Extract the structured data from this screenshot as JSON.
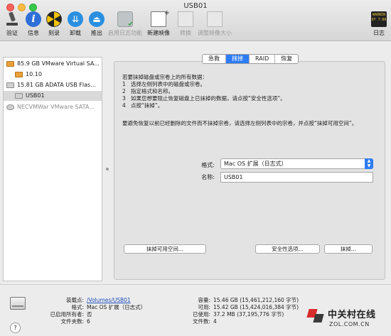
{
  "window": {
    "title": "USB01"
  },
  "toolbar": {
    "verify": "验证",
    "info": "信息",
    "burn": "刻录",
    "unmount": "卸载",
    "eject": "推出",
    "enable_journaling": "启用日志功能",
    "new_image": "新建映像",
    "convert": "转换",
    "resize_image": "调整映像大小",
    "log": "日志",
    "log_icon_text": "WARNIN\n9Y 7:86"
  },
  "sidebar": {
    "items": [
      {
        "label": "85.9 GB VMware Virtual SA..."
      },
      {
        "label": "10.10"
      },
      {
        "label": "15.81 GB ADATA USB Flas..."
      },
      {
        "label": "USB01"
      },
      {
        "label": "NECVMWar VMware SATA..."
      }
    ]
  },
  "tabs": [
    {
      "label": "急救",
      "active": false
    },
    {
      "label": "抹掉",
      "active": true
    },
    {
      "label": "RAID",
      "active": false
    },
    {
      "label": "恢复",
      "active": false
    }
  ],
  "erase": {
    "intro": "若要抹掉磁盘或宗卷上的所有数据：",
    "steps": [
      {
        "num": "1",
        "text": "选择左侧列表中的磁盘或宗卷。"
      },
      {
        "num": "2",
        "text": "指定格式和名称。"
      },
      {
        "num": "3",
        "text": "如果您想要阻止恢复磁盘上已抹掉的数据，请点按“安全性选项”。"
      },
      {
        "num": "4",
        "text": "点按“抹掉”。"
      }
    ],
    "note": "要避免恢复以前已经删除的文件而不抹掉宗卷，请选择左侧列表中的宗卷，并点按“抹掉可用空间”。",
    "format_label": "格式:",
    "format_value": "Mac OS 扩展（日志式）",
    "name_label": "名称:",
    "name_value": "USB01",
    "erase_free_space": "抹掉可用空间...",
    "security_options": "安全性选项...",
    "erase_button": "抹掉..."
  },
  "info": {
    "left": [
      {
        "key": "装载点:",
        "value": "/Volumes/USB01"
      },
      {
        "key": "格式:",
        "value": "Mac OS 扩展（日志式）"
      },
      {
        "key": "已启用所有者:",
        "value": "否"
      },
      {
        "key": "文件夹数:",
        "value": "6"
      }
    ],
    "right": [
      {
        "key": "容量:",
        "value": "15.46 GB (15,461,212,160 字节)"
      },
      {
        "key": "可用:",
        "value": "15.42 GB (15,424,016,384 字节)"
      },
      {
        "key": "已使用:",
        "value": "37.2 MB (37,195,776 字节)"
      },
      {
        "key": "文件数:",
        "value": "4"
      }
    ]
  },
  "help": "?",
  "watermark": {
    "title": "中关村在线",
    "sub": "ZOL.COM.CN"
  },
  "colors": {
    "accent": "#2e7cf6",
    "link": "#1e4fb8",
    "disk_orange": "#e9a03a"
  }
}
